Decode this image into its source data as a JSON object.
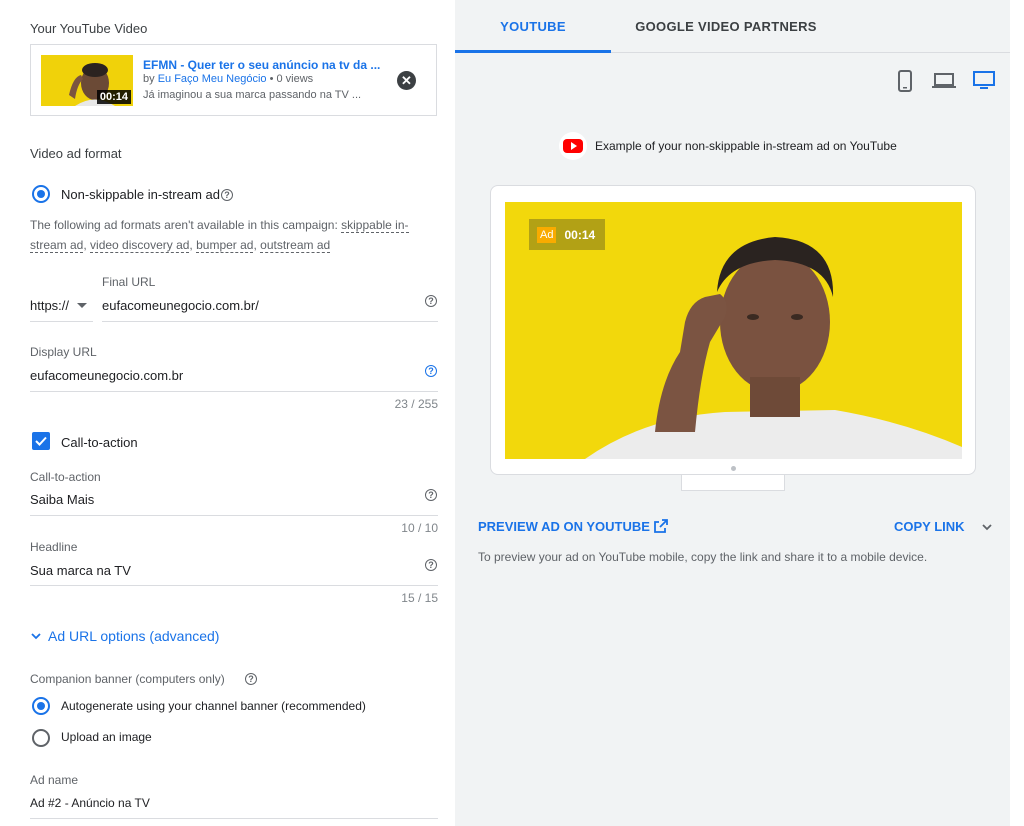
{
  "video": {
    "section_label": "Your YouTube Video",
    "title": "EFMN - Quer ter o seu anúncio na tv da ...",
    "by_prefix": "by ",
    "channel": "Eu Faço Meu Negócio",
    "views": " • 0 views",
    "description": "Já imaginou a sua marca passando na TV ...",
    "duration": "00:14",
    "remove_icon": "close-circle-icon"
  },
  "format": {
    "section_label": "Video ad format",
    "option_label": "Non-skippable in-stream ad",
    "notice_prefix": "The following ad formats aren't available in this campaign: ",
    "unavailable": [
      "skippable in-stream ad",
      "video discovery ad",
      "bumper ad",
      "outstream ad"
    ]
  },
  "final_url": {
    "label": "Final URL",
    "protocol": "https://",
    "value": "eufacomeunegocio.com.br/"
  },
  "display_url": {
    "label": "Display URL",
    "value": "eufacomeunegocio.com.br",
    "counter": "23 / 255"
  },
  "cta": {
    "checkbox_label": "Call-to-action",
    "field_label": "Call-to-action",
    "value": "Saiba Mais",
    "counter": "10 / 10"
  },
  "headline": {
    "label": "Headline",
    "value": "Sua marca na TV",
    "counter": "15 / 15"
  },
  "advanced": {
    "label": "Ad URL options (advanced)"
  },
  "companion": {
    "label": "Companion banner (computers only)",
    "option_auto": "Autogenerate using your channel banner (recommended)",
    "option_upload": "Upload an image"
  },
  "ad_name": {
    "label": "Ad name",
    "value": "Ad #2 - Anúncio na TV"
  },
  "preview": {
    "tabs": [
      {
        "label": "YOUTUBE",
        "active": true
      },
      {
        "label": "GOOGLE VIDEO PARTNERS",
        "active": false
      }
    ],
    "devices": [
      "mobile-icon",
      "laptop-icon",
      "desktop-icon"
    ],
    "active_device": "desktop-icon",
    "example_text": "Example of your non-skippable in-stream ad on YouTube",
    "ad_badge": "Ad",
    "ad_time": "00:14",
    "preview_link": "PREVIEW AD ON YOUTUBE",
    "copy_link": "COPY LINK",
    "mobile_hint": "To preview your ad on YouTube mobile, copy the link and share it to a mobile device."
  },
  "colors": {
    "accent": "#1a73e8",
    "video_yellow": "#f5d90a",
    "youtube_red": "#ff0000"
  }
}
